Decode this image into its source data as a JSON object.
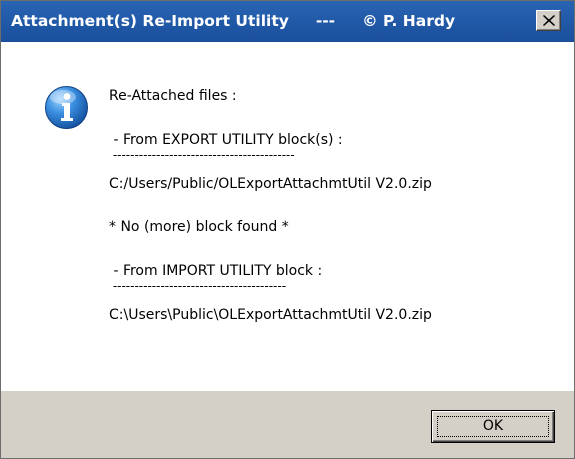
{
  "window": {
    "title": "Attachment(s) Re-Import Utility     ---     © P. Hardy"
  },
  "icons": {
    "info": "information-icon",
    "close": "close-x-icon"
  },
  "message": {
    "lines": [
      "Re-Attached files :",
      " - From EXPORT UTILITY block(s) :",
      " ------------------------------------------",
      "C:/Users/Public/OLExportAttachmtUtil V2.0.zip",
      "* No (more) block found *",
      " - From IMPORT UTILITY block :",
      " ----------------------------------------",
      "C:\\Users\\Public\\OLExportAttachmtUtil V2.0.zip"
    ]
  },
  "buttons": {
    "ok_label": "OK"
  },
  "colors": {
    "titlebar": "#1f5aa8",
    "button_face": "#d4d0c8",
    "content_bg": "#ffffff"
  }
}
